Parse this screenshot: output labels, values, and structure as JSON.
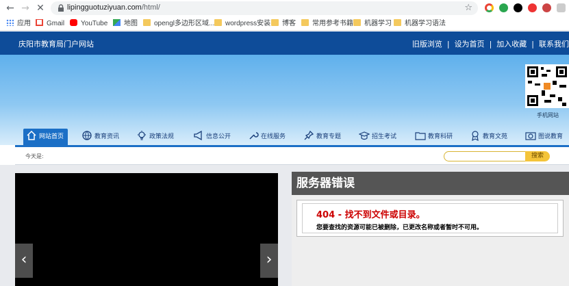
{
  "browser": {
    "url_host": "lipingguotuziyuan.com",
    "url_path": "/html/",
    "bookmarks": [
      {
        "label": "应用",
        "icon": "apps-grid-icon"
      },
      {
        "label": "Gmail",
        "icon": "gmail-icon"
      },
      {
        "label": "YouTube",
        "icon": "youtube-icon"
      },
      {
        "label": "地图",
        "icon": "maps-icon"
      },
      {
        "label": "opengl多边形区域...",
        "icon": "folder-icon"
      },
      {
        "label": "wordpress安装",
        "icon": "folder-icon"
      },
      {
        "label": "博客",
        "icon": "folder-icon"
      },
      {
        "label": "常用参考书籍",
        "icon": "folder-icon"
      },
      {
        "label": "机器学习",
        "icon": "folder-icon"
      },
      {
        "label": "机器学习语法",
        "icon": "folder-icon"
      }
    ]
  },
  "site": {
    "name": "庆阳市教育局门户网站",
    "top_links": [
      "旧版浏览",
      "设为首页",
      "加入收藏",
      "联系我们"
    ],
    "qr_label": "手机网站",
    "menu": [
      {
        "label": "网站首页",
        "icon": "home-icon"
      },
      {
        "label": "教育资讯",
        "icon": "globe-icon"
      },
      {
        "label": "政策法规",
        "icon": "lightbulb-icon"
      },
      {
        "label": "信息公开",
        "icon": "megaphone-icon"
      },
      {
        "label": "在线服务",
        "icon": "wrench-icon"
      },
      {
        "label": "教育专题",
        "icon": "pin-icon"
      },
      {
        "label": "招生考试",
        "icon": "graduation-icon"
      },
      {
        "label": "教育科研",
        "icon": "folder-outline-icon"
      },
      {
        "label": "教育文苑",
        "icon": "award-icon"
      },
      {
        "label": "图说教育",
        "icon": "camera-icon"
      }
    ],
    "date_label": "今天是:",
    "search_button": "搜索"
  },
  "error": {
    "header": "服务器错误",
    "title": "404 - 找不到文件或目录。",
    "message": "您要查找的资源可能已被删除，已更改名称或者暂时不可用。"
  },
  "colors": {
    "site_blue": "#0e4c99",
    "menu_blue": "#1b6fc6",
    "error_red": "#cc0000",
    "search_yellow": "#f4c43a"
  }
}
